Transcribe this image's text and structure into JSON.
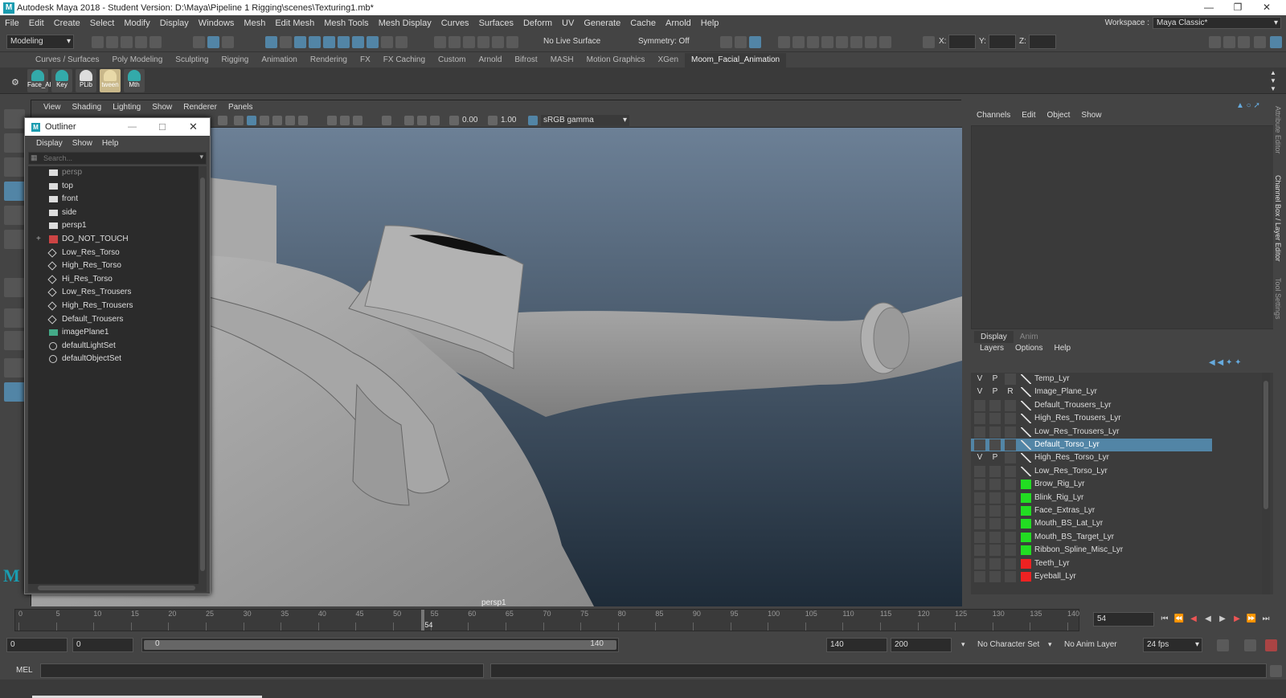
{
  "app": {
    "title": "Autodesk Maya 2018 - Student Version: D:\\Maya\\Pipeline 1 Rigging\\scenes\\Texturing1.mb*",
    "logo": "M"
  },
  "menubar": {
    "items": [
      "File",
      "Edit",
      "Create",
      "Select",
      "Modify",
      "Display",
      "Windows",
      "Mesh",
      "Edit Mesh",
      "Mesh Tools",
      "Mesh Display",
      "Curves",
      "Surfaces",
      "Deform",
      "UV",
      "Generate",
      "Cache",
      "Arnold",
      "Help"
    ],
    "workspace_label": "Workspace :",
    "workspace_value": "Maya Classic*"
  },
  "statusline": {
    "menuset": "Modeling",
    "live_surface": "No Live Surface",
    "symmetry": "Symmetry: Off",
    "x_label": "X:",
    "y_label": "Y:",
    "z_label": "Z:"
  },
  "shelf": {
    "tabs": [
      "Curves / Surfaces",
      "Poly Modeling",
      "Sculpting",
      "Rigging",
      "Animation",
      "Rendering",
      "FX",
      "FX Caching",
      "Custom",
      "Arnold",
      "Bifrost",
      "MASH",
      "Motion Graphics",
      "XGen",
      "Moom_Facial_Animation"
    ],
    "active_tab": "Moom_Facial_Animation",
    "buttons": [
      "Face_Al",
      "Key",
      "PLib",
      "tween",
      "Mth"
    ]
  },
  "viewport": {
    "menu": [
      "View",
      "Shading",
      "Lighting",
      "Show",
      "Renderer",
      "Panels"
    ],
    "exposure": "0.00",
    "gamma": "1.00",
    "colorspace": "sRGB gamma",
    "camera": "persp1"
  },
  "outliner": {
    "title": "Outliner",
    "menu": [
      "Display",
      "Show",
      "Help"
    ],
    "search_placeholder": "Search...",
    "items": [
      {
        "label": "persp",
        "icon": "camera-icon",
        "dim": true
      },
      {
        "label": "top",
        "icon": "camera-icon"
      },
      {
        "label": "front",
        "icon": "camera-icon"
      },
      {
        "label": "side",
        "icon": "camera-icon"
      },
      {
        "label": "persp1",
        "icon": "camera-icon"
      },
      {
        "label": "DO_NOT_TOUCH",
        "icon": "group-icon",
        "expand": "+"
      },
      {
        "label": "Low_Res_Torso",
        "icon": "mesh-icon"
      },
      {
        "label": "High_Res_Torso",
        "icon": "mesh-icon"
      },
      {
        "label": "Hi_Res_Torso",
        "icon": "mesh-icon"
      },
      {
        "label": "Low_Res_Trousers",
        "icon": "mesh-icon"
      },
      {
        "label": "High_Res_Trousers",
        "icon": "mesh-icon"
      },
      {
        "label": "Default_Trousers",
        "icon": "mesh-icon"
      },
      {
        "label": "imagePlane1",
        "icon": "imageplane-icon"
      },
      {
        "label": "defaultLightSet",
        "icon": "set-icon"
      },
      {
        "label": "defaultObjectSet",
        "icon": "set-icon"
      }
    ]
  },
  "channelbox": {
    "menu": [
      "Channels",
      "Edit",
      "Object",
      "Show"
    ],
    "layer_tabs": [
      "Display",
      "Anim"
    ],
    "active_layer_tab": "Display",
    "layer_menu": [
      "Layers",
      "Options",
      "Help"
    ],
    "layers": [
      {
        "name": "Temp_Lyr",
        "v": "V",
        "p": "P",
        "r": "",
        "color": ""
      },
      {
        "name": "Image_Plane_Lyr",
        "v": "V",
        "p": "P",
        "r": "R",
        "color": ""
      },
      {
        "name": "Default_Trousers_Lyr",
        "v": "",
        "p": "",
        "r": "",
        "color": ""
      },
      {
        "name": "High_Res_Trousers_Lyr",
        "v": "",
        "p": "",
        "r": "",
        "color": ""
      },
      {
        "name": "Low_Res_Trousers_Lyr",
        "v": "",
        "p": "",
        "r": "",
        "color": ""
      },
      {
        "name": "Default_Torso_Lyr",
        "v": "",
        "p": "",
        "r": "",
        "color": "",
        "selected": true
      },
      {
        "name": "High_Res_Torso_Lyr",
        "v": "V",
        "p": "P",
        "r": "",
        "color": ""
      },
      {
        "name": "Low_Res_Torso_Lyr",
        "v": "",
        "p": "",
        "r": "",
        "color": ""
      },
      {
        "name": "Brow_Rig_Lyr",
        "v": "",
        "p": "",
        "r": "",
        "color": "#22dd22"
      },
      {
        "name": "Blink_Rig_Lyr",
        "v": "",
        "p": "",
        "r": "",
        "color": "#22dd22"
      },
      {
        "name": "Face_Extras_Lyr",
        "v": "",
        "p": "",
        "r": "",
        "color": "#22dd22"
      },
      {
        "name": "Mouth_BS_Lat_Lyr",
        "v": "",
        "p": "",
        "r": "",
        "color": "#22dd22"
      },
      {
        "name": "Mouth_BS_Target_Lyr",
        "v": "",
        "p": "",
        "r": "",
        "color": "#22dd22"
      },
      {
        "name": "Ribbon_Spline_Misc_Lyr",
        "v": "",
        "p": "",
        "r": "",
        "color": "#22dd22"
      },
      {
        "name": "Teeth_Lyr",
        "v": "",
        "p": "",
        "r": "",
        "color": "#ee2222"
      },
      {
        "name": "Eyeball_Lyr",
        "v": "",
        "p": "",
        "r": "",
        "color": "#ee2222"
      }
    ],
    "side_tabs": [
      "Attribute Editor",
      "Channel Box / Layer Editor",
      "Tool Settings"
    ]
  },
  "timeslider": {
    "ticks": [
      "0",
      "5",
      "10",
      "15",
      "20",
      "25",
      "30",
      "35",
      "40",
      "45",
      "50",
      "55",
      "60",
      "65",
      "70",
      "75",
      "80",
      "85",
      "90",
      "95",
      "100",
      "105",
      "110",
      "115",
      "120",
      "125",
      "130",
      "135",
      "140"
    ],
    "current_frame_marker": "54",
    "current_frame": "54"
  },
  "rangeslider": {
    "start": "0",
    "playback_start": "0",
    "range_min": "0",
    "range_max": "140",
    "playback_end": "140",
    "end": "200",
    "character_set": "No Character Set",
    "anim_layer": "No Anim Layer",
    "fps": "24 fps"
  },
  "cmdline": {
    "label": "MEL"
  },
  "colors": {
    "bg": "#444444",
    "accent": "#5285a6",
    "viewport_top": "#6c8096",
    "viewport_bottom": "#1e2b38"
  }
}
